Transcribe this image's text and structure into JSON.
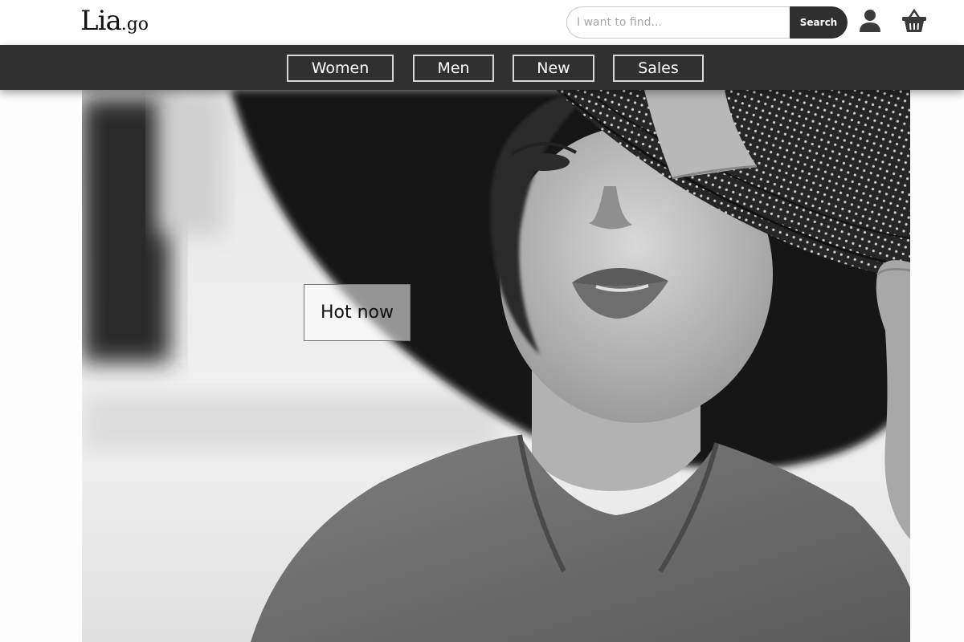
{
  "header": {
    "logo_main": "Lia",
    "logo_sub": ".go",
    "search": {
      "placeholder": "I want to find...",
      "value": "",
      "button_label": "Search"
    },
    "icons": {
      "account": "user-icon",
      "cart": "basket-icon"
    }
  },
  "nav": {
    "items": [
      {
        "label": "Women"
      },
      {
        "label": "Men"
      },
      {
        "label": "New"
      },
      {
        "label": "Sales"
      }
    ]
  },
  "hero": {
    "cta_label": "Hot now",
    "image_subject": "black-and-white photo of a woman in a wide-brimmed hat"
  },
  "colors": {
    "nav_background": "#303030",
    "search_button": "#2f2f2f",
    "page_background": "#fdfdfd"
  }
}
